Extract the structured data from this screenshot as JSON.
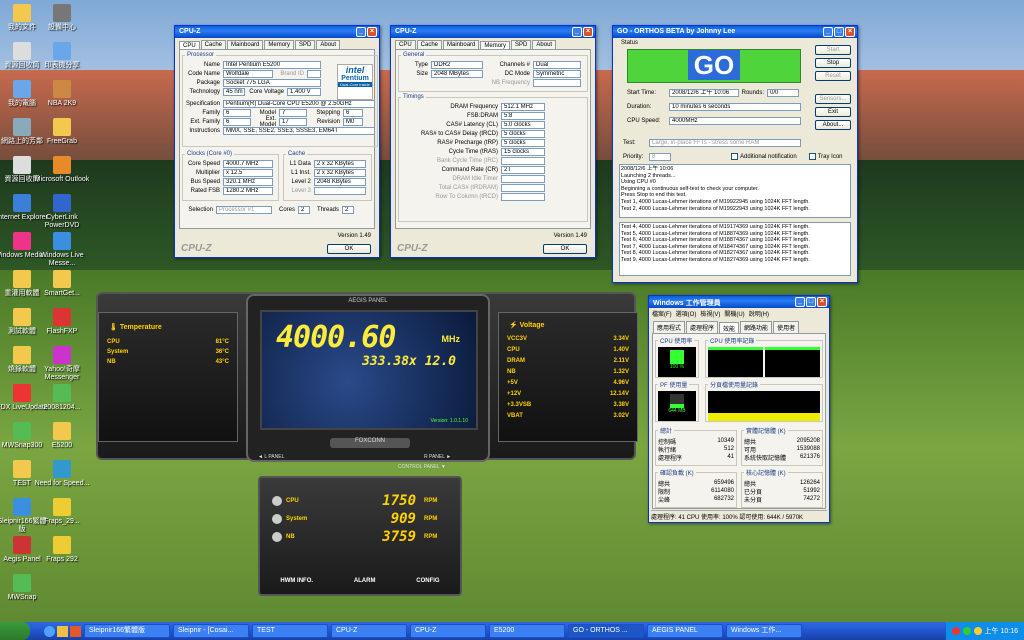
{
  "desktop": {
    "icons": [
      {
        "label": "我的文件"
      },
      {
        "label": "資源回收筒"
      },
      {
        "label": "我的電腦"
      },
      {
        "label": "網路上的芳鄰"
      },
      {
        "label": "資源回收筒"
      },
      {
        "label": "Internet Explorer"
      },
      {
        "label": "Windows Media..."
      },
      {
        "label": "重灌用軟體"
      },
      {
        "label": "測試軟體"
      },
      {
        "label": "燒錄軟體"
      },
      {
        "label": "FDX LiveUpdate"
      },
      {
        "label": "MWSnap300"
      },
      {
        "label": "TEST"
      },
      {
        "label": "Sleipnir166繁體版"
      },
      {
        "label": "Aegis Panel"
      },
      {
        "label": "MWSnap"
      },
      {
        "label": "設備中心"
      },
      {
        "label": "印表機分享"
      },
      {
        "label": "NBA 2K9"
      },
      {
        "label": "FreeGrab"
      },
      {
        "label": "Microsoft Outlook"
      },
      {
        "label": "CyberLink PowerDVD"
      },
      {
        "label": "Windows Live Messe..."
      },
      {
        "label": "SmartGet..."
      },
      {
        "label": "FlashFXP"
      },
      {
        "label": "Yahoo!奇摩 Messenger"
      },
      {
        "label": "20081204..."
      },
      {
        "label": "E5200"
      },
      {
        "label": "Need for Speed..."
      },
      {
        "label": "Fraps_29..."
      },
      {
        "label": "Fraps 292"
      }
    ]
  },
  "cpuz1": {
    "title": "CPU-Z",
    "tabs": [
      "CPU",
      "Cache",
      "Mainboard",
      "Memory",
      "SPD",
      "About"
    ],
    "processor": {
      "legend": "Processor",
      "name_l": "Name",
      "name": "Intel Pentium E5200",
      "code_l": "Code Name",
      "code": "Wolfdale",
      "brand_l": "Brand ID",
      "pkg_l": "Package",
      "pkg": "Socket 775 LGA",
      "tech_l": "Technology",
      "tech": "45 nm",
      "cv_l": "Core Voltage",
      "cv": "1.400 V",
      "spec_l": "Specification",
      "spec": "Pentium(R) Dual-Core CPU E5200 @ 2.50GHz",
      "fam_l": "Family",
      "fam": "6",
      "model_l": "Model",
      "model": "7",
      "step_l": "Stepping",
      "step": "6",
      "efam_l": "Ext. Family",
      "efam": "6",
      "emod_l": "Ext. Model",
      "emod": "17",
      "rev_l": "Revision",
      "rev": "M0",
      "ins_l": "Instructions",
      "ins": "MMX, SSE, SSE2, SSE3, SSSE3, EM64T",
      "logo1": "intel",
      "logo2": "Pentium",
      "logo3": "Dual-Core inside"
    },
    "clocks": {
      "legend": "Clocks (Core #0)",
      "cs_l": "Core Speed",
      "cs": "4000.7 MHz",
      "mul_l": "Multiplier",
      "mul": "x 12.5",
      "bus_l": "Bus Speed",
      "bus": "320.1 MHz",
      "fsb_l": "Rated FSB",
      "fsb": "1280.2 MHz"
    },
    "cache": {
      "legend": "Cache",
      "l1d_l": "L1 Data",
      "l1d": "2 x 32 KBytes",
      "l1i_l": "L1 Inst.",
      "l1i": "2 x 32 KBytes",
      "l2_l": "Level 2",
      "l2": "2048 KBytes",
      "l3_l": "Level 3"
    },
    "sel_l": "Selection",
    "sel": "Processor #1",
    "cores_l": "Cores",
    "cores": "2",
    "threads_l": "Threads",
    "threads": "2",
    "version": "Version 1.49",
    "brand": "CPU-Z",
    "ok": "OK"
  },
  "cpuz2": {
    "title": "CPU-Z",
    "tabs": [
      "CPU",
      "Cache",
      "Mainboard",
      "Memory",
      "SPD",
      "About"
    ],
    "general": {
      "legend": "General",
      "type_l": "Type",
      "type": "DDR2",
      "ch_l": "Channels #",
      "ch": "Dual",
      "size_l": "Size",
      "size": "2048 MBytes",
      "dc_l": "DC Mode",
      "dc": "Symmetric",
      "nb_l": "NB Frequency"
    },
    "timings": {
      "legend": "Timings",
      "rows": [
        {
          "l": "DRAM Frequency",
          "v": "512.1 MHz"
        },
        {
          "l": "FSB:DRAM",
          "v": "5:8"
        },
        {
          "l": "CAS# Latency (CL)",
          "v": "5.0 clocks"
        },
        {
          "l": "RAS# to CAS# Delay (tRCD)",
          "v": "5 clocks"
        },
        {
          "l": "RAS# Precharge (tRP)",
          "v": "5 clocks"
        },
        {
          "l": "Cycle Time (tRAS)",
          "v": "15 clocks"
        },
        {
          "l": "Bank Cycle Time (tRC)",
          "v": ""
        },
        {
          "l": "Command Rate (CR)",
          "v": "2T"
        },
        {
          "l": "DRAM Idle Timer",
          "v": ""
        },
        {
          "l": "Total CAS# (tRDRAM)",
          "v": ""
        },
        {
          "l": "Row To Column (tRCD)",
          "v": ""
        }
      ]
    },
    "version": "Version 1.49",
    "brand": "CPU-Z",
    "ok": "OK"
  },
  "orthos": {
    "title": "GO - ORTHOS BETA by Johnny Lee",
    "status_l": "Status",
    "go": "GO",
    "start_l": "Start Time:",
    "start": "2008/12/6 上午 10:06",
    "rounds_l": "Rounds:",
    "rounds": "0/0",
    "dur_l": "Duration:",
    "dur": "10 minutes 6 seconds",
    "speed_l": "CPU Speed:",
    "speed": "4000MHz",
    "test_l": "Test:",
    "test": "Large, in-place FFTs - stress some RAM",
    "prio_l": "Priority:",
    "prio": "8",
    "addinfo": "Additional notification",
    "tray": "Tray Icon",
    "buttons": [
      "Start",
      "Stop",
      "Reset",
      "Sensors...",
      "Exit",
      "About..."
    ],
    "log1": [
      "2008/12/6 上午 10:06",
      "Launching 2 threads...",
      "Using CPU #0",
      "Beginning a continuous self-test to check your computer.",
      "Press Stop to end this test.",
      "Test 1, 4000 Lucas-Lehmer iterations of M19922945 using 1024K FFT length.",
      "Test 2, 4000 Lucas-Lehmer iterations of M19922943 using 1024K FFT length."
    ],
    "log2": [
      "Test 4, 4000 Lucas-Lehmer iterations of M19174369 using 1024K FFT length.",
      "Test 5, 4000 Lucas-Lehmer iterations of M18874369 using 1024K FFT length.",
      "Test 6, 4000 Lucas-Lehmer iterations of M18874367 using 1024K FFT length.",
      "Test 7, 4000 Lucas-Lehmer iterations of M18474367 using 1024K FFT length.",
      "Test 8, 4000 Lucas-Lehmer iterations of M18274367 using 1024K FFT length.",
      "Test 9, 4000 Lucas-Lehmer iterations of M18274369 using 1024K FFT length."
    ]
  },
  "taskmgr": {
    "title": "Windows 工作管理員",
    "menu": [
      "檔案(F)",
      "選項(O)",
      "檢視(V)",
      "關機(U)",
      "說明(H)"
    ],
    "tabs": [
      "應用程式",
      "處理程序",
      "效能",
      "網路功能",
      "使用者"
    ],
    "cpu_use_l": "CPU 使用率",
    "cpu_use": "100 %",
    "cpu_hist_l": "CPU 使用率記錄",
    "pf_l": "PF 使用量",
    "pf": "644 MB",
    "pf_hist_l": "分頁檔使用量記錄",
    "totals": {
      "legend": "總計",
      "rows": [
        {
          "l": "控制碼",
          "v": "10349"
        },
        {
          "l": "執行緒",
          "v": "512"
        },
        {
          "l": "處理程序",
          "v": "41"
        }
      ]
    },
    "phys": {
      "legend": "實體記憶體 (K)",
      "rows": [
        {
          "l": "總共",
          "v": "2095208"
        },
        {
          "l": "可用",
          "v": "1539088"
        },
        {
          "l": "系統快取記憶體",
          "v": "621376"
        }
      ]
    },
    "commit": {
      "legend": "確認負載 (K)",
      "rows": [
        {
          "l": "總共",
          "v": "659496"
        },
        {
          "l": "限制",
          "v": "6114080"
        },
        {
          "l": "尖峰",
          "v": "682732"
        }
      ]
    },
    "kernel": {
      "legend": "核心記憶體 (K)",
      "rows": [
        {
          "l": "總共",
          "v": "126264"
        },
        {
          "l": "已分頁",
          "v": "51992"
        },
        {
          "l": "未分頁",
          "v": "74272"
        }
      ]
    },
    "status": "處理程序: 41   CPU 使用率: 100%   認可使用: 644K / 5970K"
  },
  "aegis": {
    "top": "AEGIS PANEL",
    "bignum": "4000.60",
    "mhz": "MHz",
    "sub": "333.38x 12.0",
    "ver": "Version: 1.0.1.10",
    "brand": "FOXCONN",
    "lpanel": "◄ L PANEL",
    "rpanel": "R PANEL ►",
    "cpanel": "CONTROL PANEL ▼",
    "temp": {
      "title": "Temperature",
      "rows": [
        {
          "l": "CPU",
          "v": "81°C"
        },
        {
          "l": "System",
          "v": "36°C"
        },
        {
          "l": "NB",
          "v": "43°C"
        }
      ]
    },
    "volt": {
      "title": "Voltage",
      "rows": [
        {
          "l": "VCC3V",
          "v": "3.34V"
        },
        {
          "l": "CPU",
          "v": "1.40V"
        },
        {
          "l": "DRAM",
          "v": "2.11V"
        },
        {
          "l": "NB",
          "v": "1.32V"
        },
        {
          "l": "+5V",
          "v": "4.96V"
        },
        {
          "l": "+12V",
          "v": "12.14V"
        },
        {
          "l": "+3.3VSB",
          "v": "3.38V"
        },
        {
          "l": "VBAT",
          "v": "3.02V"
        }
      ]
    },
    "fans": [
      {
        "l": "CPU",
        "v": "1750",
        "u": "RPM"
      },
      {
        "l": "System",
        "v": "909",
        "u": "RPM"
      },
      {
        "l": "NB",
        "v": "3759",
        "u": "RPM"
      }
    ],
    "bottom": [
      "HWM INFO.",
      "ALARM",
      "CONFIG"
    ]
  },
  "taskbar": {
    "items": [
      "Sleipnir166繁體版",
      "Sleipnir - [Cosai...",
      "TEST",
      "CPU-Z",
      "CPU-Z",
      "E5200",
      "GO - ORTHOS ...",
      "AEGIS PANEL",
      "Windows 工作..."
    ],
    "clock": "上午 10:16",
    "start_label": ""
  }
}
